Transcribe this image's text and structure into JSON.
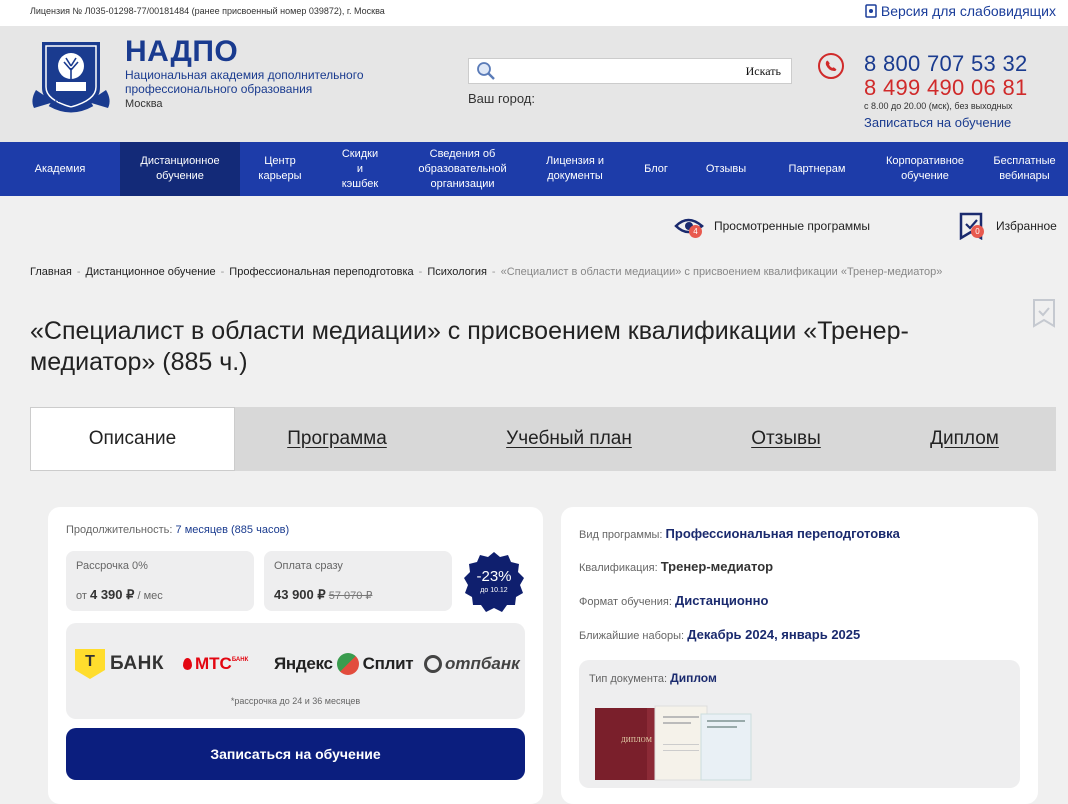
{
  "topbar": {
    "license": "Лицензия № Л035-01298-77/00181484 (ранее присвоенный номер 039872), г. Москва",
    "vision_link": "Версия для слабовидящих"
  },
  "header": {
    "brand_name": "НАДПО",
    "brand_subtitle": "Национальная академия дополнительного профессионального образования",
    "brand_city": "Москва",
    "search_placeholder": "",
    "search_button": "Искать",
    "city_label": "Ваш город:",
    "phone_primary": "8 800 707 53 32",
    "phone_secondary": "8 499 490 06 81",
    "hours": "с 8.00 до 20.00 (мск), без выходных",
    "signup_link": "Записаться на обучение"
  },
  "nav": {
    "items": [
      {
        "label": "Академия"
      },
      {
        "label": "Дистанционное обучение"
      },
      {
        "label": "Центр карьеры"
      },
      {
        "label": "Скидки и кэшбек"
      },
      {
        "label": "Сведения об образовательной организации"
      },
      {
        "label": "Лицензия и документы"
      },
      {
        "label": "Блог"
      },
      {
        "label": "Отзывы"
      },
      {
        "label": "Партнерам"
      },
      {
        "label": "Корпоративное обучение"
      },
      {
        "label": "Бесплатные вебинары"
      }
    ],
    "active_index": 1
  },
  "tools": {
    "viewed_label": "Просмотренные программы",
    "viewed_count": "4",
    "favorites_label": "Избранное",
    "favorites_count": "0"
  },
  "breadcrumb": {
    "items": [
      "Главная",
      "Дистанционное обучение",
      "Профессиональная переподготовка",
      "Психология"
    ],
    "current": "«Специалист в области медиации» с присвоением квалификации «Тренер-медиатор»"
  },
  "page": {
    "title": "«Специалист в области медиации» с присвоением квалификации «Тренер-медиатор» (885 ч.)"
  },
  "tabs": [
    {
      "label": "Описание"
    },
    {
      "label": "Программа"
    },
    {
      "label": "Учебный план"
    },
    {
      "label": "Отзывы"
    },
    {
      "label": "Диплом"
    }
  ],
  "pricing": {
    "duration_label": "Продолжительность:",
    "duration_value": "7 месяцев (885 часов)",
    "installment_label": "Рассрочка 0%",
    "installment_prefix": "от",
    "installment_price": "4 390 ₽",
    "installment_suffix": "/ мес",
    "full_label": "Оплата сразу",
    "full_price": "43 900 ₽",
    "old_price": "57 070 ₽",
    "discount": "-23%",
    "discount_until": "до 10.12",
    "banks": [
      "Т",
      "БАНК",
      "МТС",
      "БАНК",
      "Яндекс",
      "Сплит",
      "отпбанк"
    ],
    "bank_note": "*рассрочка до 24 и 36 месяцев",
    "enroll_button": "Записаться на обучение"
  },
  "details": {
    "type_label": "Вид программы:",
    "type_value": "Профессиональная переподготовка",
    "qual_label": "Квалификация:",
    "qual_value": "Тренер-медиатор",
    "format_label": "Формат обучения:",
    "format_value": "Дистанционно",
    "intake_label": "Ближайшие наборы:",
    "intake_value": "Декабрь 2024, январь 2025",
    "doc_label": "Тип документа:",
    "doc_value": "Диплом",
    "diploma_cover_text": "ДИПЛОМ"
  },
  "colors": {
    "brand_blue": "#1a3b8f",
    "nav_bg": "#1d3ca9",
    "nav_active": "#132a78",
    "phone_red": "#d02a2a",
    "button_dark": "#0b1e7e",
    "discount_bg": "#0f1f6e"
  }
}
